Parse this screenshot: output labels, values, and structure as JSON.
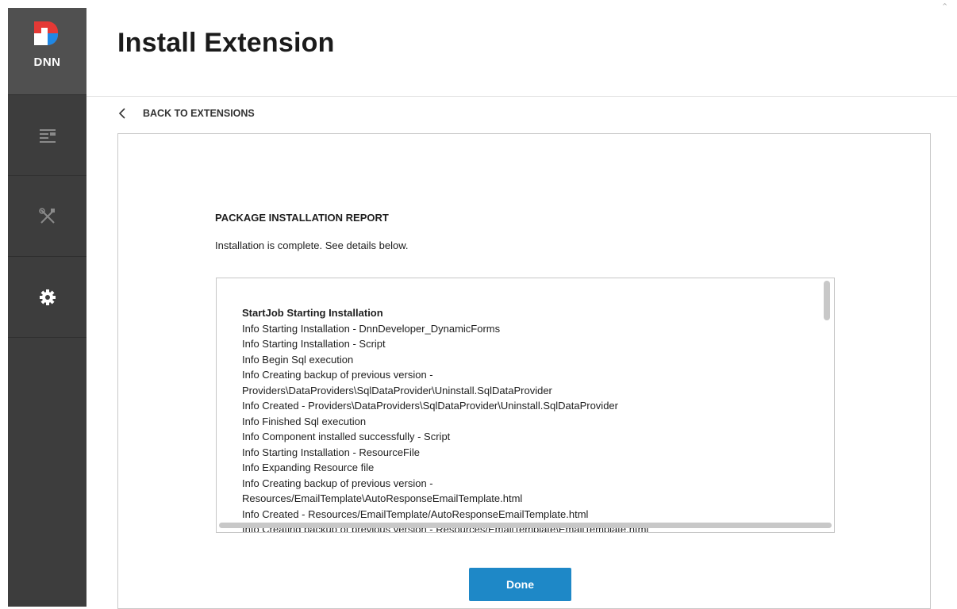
{
  "app": {
    "logo_text": "DNN"
  },
  "colors": {
    "sidebar_bg": "#3d3d3d",
    "logo_red": "#e53935",
    "logo_blue": "#1e88e5",
    "accent": "#1e88c7"
  },
  "sidebar": {
    "items": [
      {
        "icon": "content-list-icon"
      },
      {
        "icon": "tools-icon"
      },
      {
        "icon": "gear-icon",
        "active": true
      }
    ]
  },
  "header": {
    "title": "Install Extension"
  },
  "nav": {
    "back_label": "BACK TO EXTENSIONS"
  },
  "report": {
    "title": "PACKAGE INSTALLATION REPORT",
    "subtitle": "Installation is complete. See details below.",
    "log_lines": [
      {
        "text": "StartJob Starting Installation",
        "bold": true
      },
      {
        "text": "Info Starting Installation - DnnDeveloper_DynamicForms",
        "bold": false
      },
      {
        "text": "Info Starting Installation - Script",
        "bold": false
      },
      {
        "text": "Info Begin Sql execution",
        "bold": false
      },
      {
        "text": "Info Creating backup of previous version -",
        "bold": false
      },
      {
        "text": "Providers\\DataProviders\\SqlDataProvider\\Uninstall.SqlDataProvider",
        "bold": false
      },
      {
        "text": "Info Created - Providers\\DataProviders\\SqlDataProvider\\Uninstall.SqlDataProvider",
        "bold": false
      },
      {
        "text": "Info Finished Sql execution",
        "bold": false
      },
      {
        "text": "Info Component installed successfully - Script",
        "bold": false
      },
      {
        "text": "Info Starting Installation - ResourceFile",
        "bold": false
      },
      {
        "text": "Info Expanding Resource file",
        "bold": false
      },
      {
        "text": "Info Creating backup of previous version -",
        "bold": false
      },
      {
        "text": "Resources/EmailTemplate\\AutoResponseEmailTemplate.html",
        "bold": false
      },
      {
        "text": "Info Created - Resources/EmailTemplate/AutoResponseEmailTemplate.html",
        "bold": false
      },
      {
        "text": "Info Creating backup of previous version - Resources/EmailTemplate\\EmailTemplate.html",
        "bold": false
      }
    ]
  },
  "actions": {
    "done_label": "Done"
  }
}
